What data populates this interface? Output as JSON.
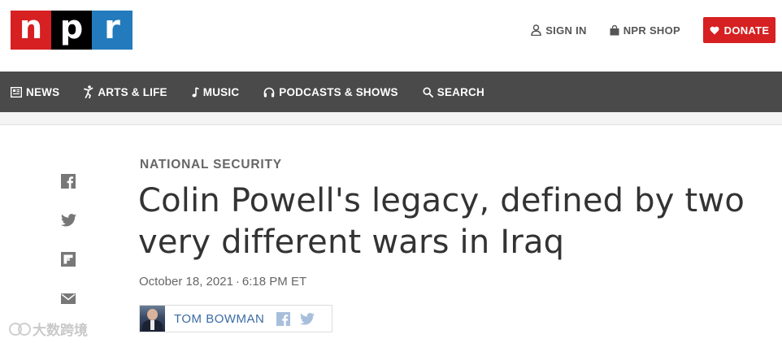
{
  "logo": {
    "letters": [
      "n",
      "p",
      "r"
    ]
  },
  "header": {
    "sign_in": "SIGN IN",
    "shop": "NPR SHOP",
    "donate": "DONATE"
  },
  "nav": {
    "items": [
      {
        "label": "NEWS",
        "icon": "news-icon"
      },
      {
        "label": "ARTS & LIFE",
        "icon": "arts-life-icon"
      },
      {
        "label": "MUSIC",
        "icon": "music-note-icon"
      },
      {
        "label": "PODCASTS & SHOWS",
        "icon": "headphones-icon"
      },
      {
        "label": "SEARCH",
        "icon": "search-icon"
      }
    ]
  },
  "share": [
    "facebook-icon",
    "twitter-icon",
    "flipboard-icon",
    "email-icon"
  ],
  "article": {
    "section": "NATIONAL SECURITY",
    "headline": "Colin Powell's legacy, defined by two very different wars in Iraq",
    "date": "October 18, 2021",
    "separator": "·",
    "time": "6:18 PM ET",
    "author": "TOM BOWMAN"
  },
  "watermark": {
    "text": "大数跨境"
  },
  "colors": {
    "npr_red": "#d62021",
    "npr_black": "#000000",
    "npr_blue": "#237bbd",
    "nav_bg": "#4a4a4a",
    "author_link": "#3a6ba5"
  }
}
